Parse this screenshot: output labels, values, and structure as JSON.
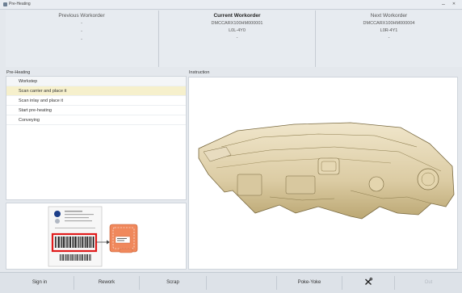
{
  "window": {
    "title": "Pre-Heating",
    "minimize_glyph": "–",
    "close_glyph": "✕"
  },
  "workorders": {
    "previous": {
      "header": "Previous Workorder",
      "lines": [
        "-",
        "-",
        "-"
      ]
    },
    "current": {
      "header": "Current Workorder",
      "lines": [
        "DMCCARX100HM000001",
        "L0L-4Y0",
        "-"
      ]
    },
    "next": {
      "header": "Next Workorder",
      "lines": [
        "DMCCARX100HM000004",
        "L0R-4Y1",
        "-"
      ]
    }
  },
  "steps_panel": {
    "title": "Pre-Heating",
    "header": "Workstep",
    "items": [
      "Scan carrier and place it",
      "Scan inlay and place it",
      "Start pre-heating",
      "Conveying"
    ],
    "active_index": 0
  },
  "instruction_panel": {
    "title": "Instruction"
  },
  "toolbar": {
    "sign_in": "Sign in",
    "rework": "Rework",
    "scrap": "Scrap",
    "poke_yoke": "Poke-Yoke",
    "tools_icon": "tools-icon",
    "out": "Out"
  },
  "colors": {
    "active_step": "#f6f0cc",
    "highlight_box": "#e01b1b",
    "part_color": "#e8dcc0"
  }
}
